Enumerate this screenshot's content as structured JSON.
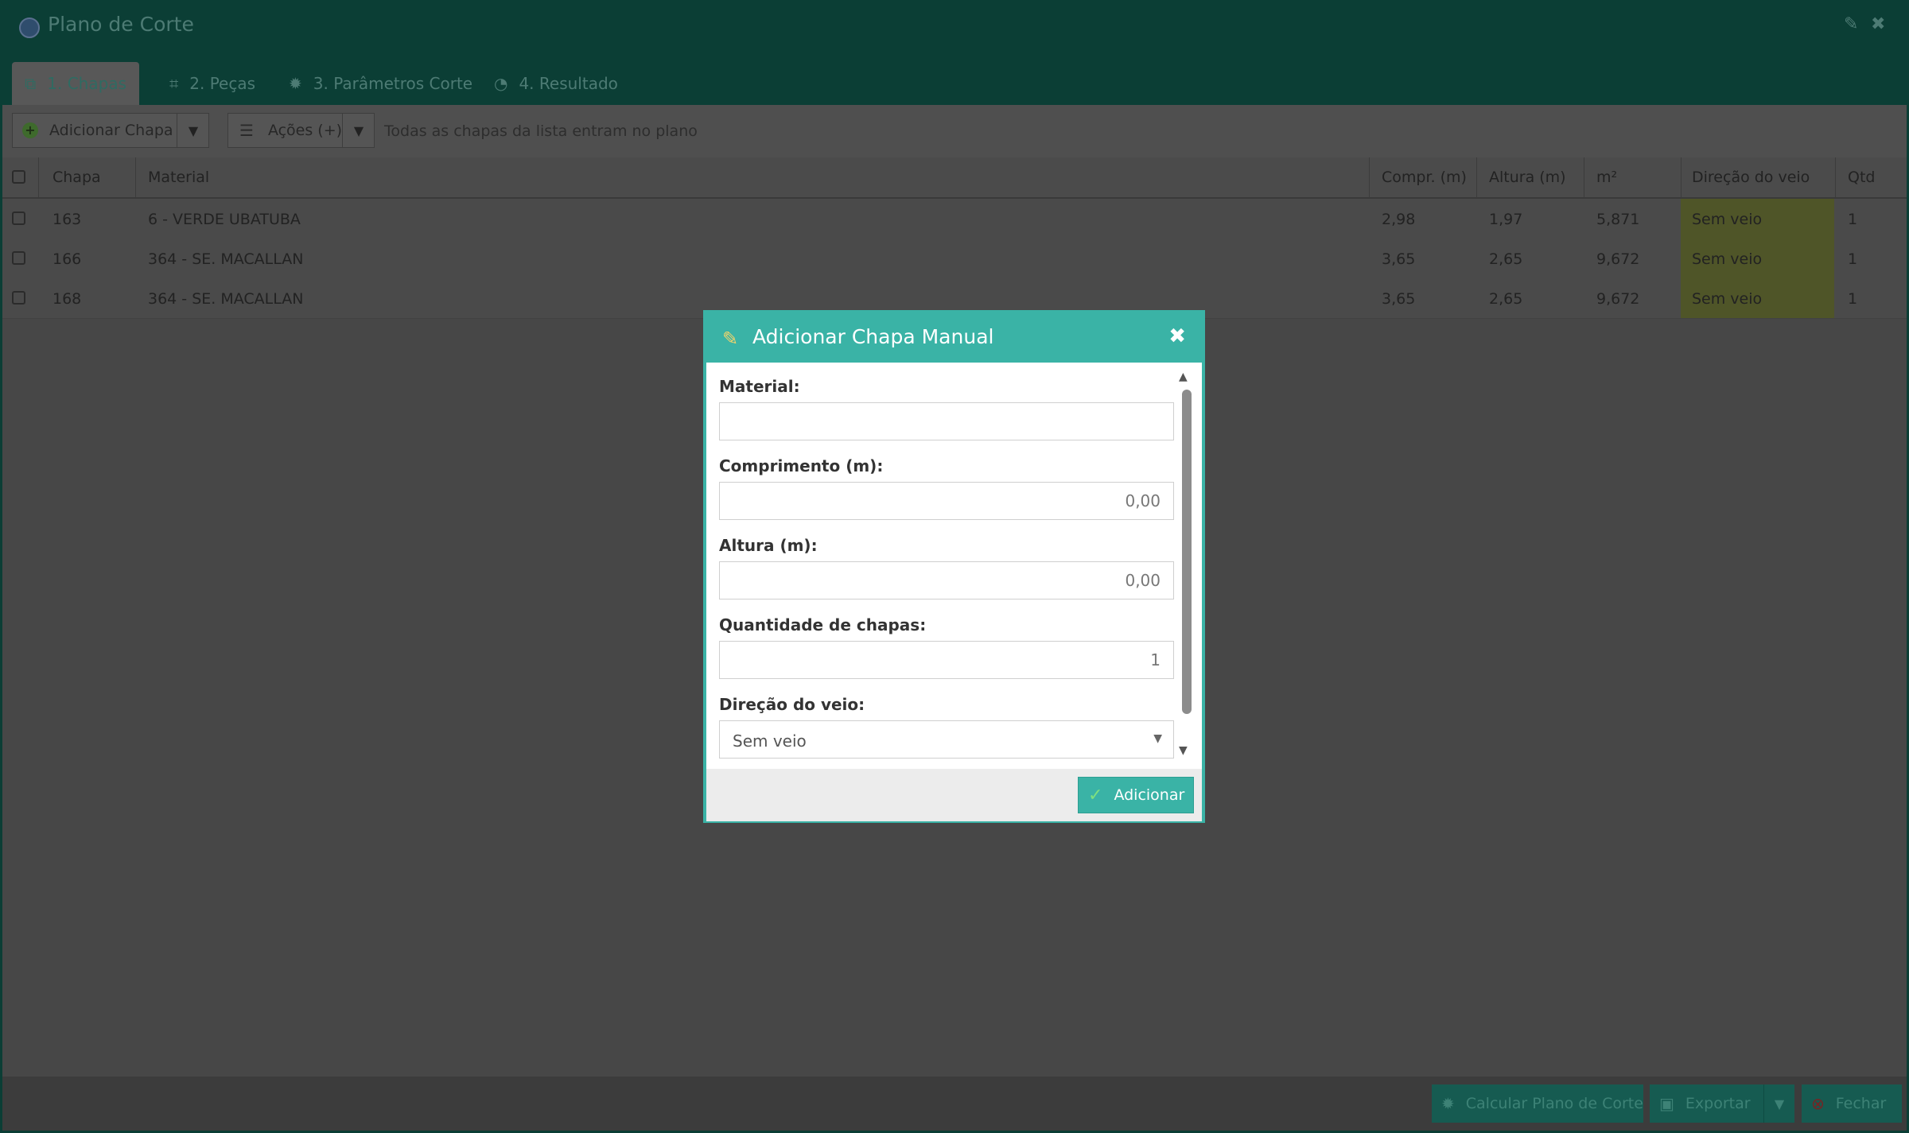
{
  "window": {
    "title": "Plano de Corte",
    "controls": {
      "pin": "✎",
      "close": "✖"
    }
  },
  "tabs": [
    {
      "label": "1. Chapas",
      "icon": "sheets-icon",
      "glyph": "⧉"
    },
    {
      "label": "2. Peças",
      "icon": "crop-icon",
      "glyph": "⌗"
    },
    {
      "label": "3. Parâmetros Corte",
      "icon": "gear-icon",
      "glyph": "✹"
    },
    {
      "label": "4. Resultado",
      "icon": "pie-chart-icon",
      "glyph": "◔"
    }
  ],
  "toolbar": {
    "add_sheet_label": "Adicionar Chapa",
    "actions_label": "Ações (+)",
    "hint": "Todas as chapas da lista entram no plano"
  },
  "grid": {
    "columns": [
      "Chapa",
      "Material",
      "Compr. (m)",
      "Altura (m)",
      "m²",
      "Direção do veio",
      "Qtd"
    ],
    "rows": [
      {
        "chapa": "163",
        "material": "6 - VERDE UBATUBA",
        "compr": "2,98",
        "altura": "1,97",
        "m2": "5,871",
        "veio": "Sem veio",
        "qtd": "1"
      },
      {
        "chapa": "166",
        "material": "364 - SE. MACALLAN",
        "compr": "3,65",
        "altura": "2,65",
        "m2": "9,672",
        "veio": "Sem veio",
        "qtd": "1"
      },
      {
        "chapa": "168",
        "material": "364 - SE. MACALLAN",
        "compr": "3,65",
        "altura": "2,65",
        "m2": "9,672",
        "veio": "Sem veio",
        "qtd": "1"
      }
    ]
  },
  "footer": {
    "calc_label": "Calcular Plano de Corte",
    "export_label": "Exportar",
    "close_label": "Fechar"
  },
  "modal": {
    "title": "Adicionar Chapa Manual",
    "fields": {
      "material_label": "Material:",
      "material_value": "",
      "comprimento_label": "Comprimento (m):",
      "comprimento_value": "0,00",
      "altura_label": "Altura (m):",
      "altura_value": "0,00",
      "quantidade_label": "Quantidade de chapas:",
      "quantidade_value": "1",
      "direcao_label": "Direção do veio:",
      "direcao_value": "Sem veio"
    },
    "submit_label": "Adicionar"
  },
  "colors": {
    "accent": "#3ab3a6",
    "titlebar": "#0b3e35",
    "grain_cell": "#4f5528"
  }
}
